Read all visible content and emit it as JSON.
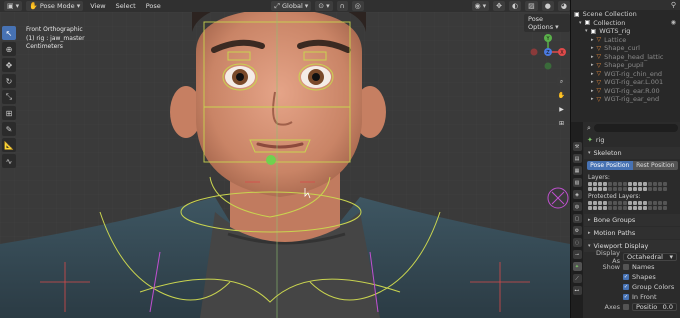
{
  "header": {
    "mode": "Pose Mode",
    "menus": [
      "View",
      "Select",
      "Pose"
    ],
    "orientation": "Global",
    "pose_options": "Pose Options"
  },
  "viewport": {
    "view_name": "Front Orthographic",
    "object_info": "(1) rig : jaw_master",
    "units": "Centimeters"
  },
  "gizmo": {
    "x_label": "X",
    "y_label": "Y",
    "z_label": "Z"
  },
  "outliner": {
    "scene": "Scene Collection",
    "collection": "Collection",
    "items": [
      {
        "name": "WGTS_rig",
        "muted": false
      },
      {
        "name": "Lattice",
        "muted": true
      },
      {
        "name": "Shape_curl",
        "muted": true
      },
      {
        "name": "Shape_head_lattic",
        "muted": true
      },
      {
        "name": "Shape_pupil",
        "muted": true
      },
      {
        "name": "WGT-rig_chin_end",
        "muted": true
      },
      {
        "name": "WGT-rig_ear.L.001",
        "muted": true
      },
      {
        "name": "WGT-rig_ear.R.00",
        "muted": true
      },
      {
        "name": "WGT-rig_ear_end",
        "muted": true
      }
    ]
  },
  "properties": {
    "object_name": "rig",
    "skeleton_section": "Skeleton",
    "pose_position": "Pose Position",
    "rest_position": "Rest Position",
    "layers_label": "Layers:",
    "protected_label": "Protected Layers:",
    "bone_groups": "Bone Groups",
    "motion_paths": "Motion Paths",
    "viewport_display": "Viewport Display",
    "display_as_label": "Display As",
    "display_as_value": "Octahedral",
    "show_label": "Show",
    "names": "Names",
    "shapes": "Shapes",
    "group_colors": "Group Colors",
    "in_front": "In Front",
    "axes": "Axes",
    "position_label": "Positio",
    "position_value": "0.0"
  },
  "colors": {
    "accent": "#4772b3",
    "header_bg": "#303030",
    "panel_bg": "#2b2b2b",
    "bone_yellow": "#c9d44f",
    "bone_green": "#6fd24f"
  }
}
